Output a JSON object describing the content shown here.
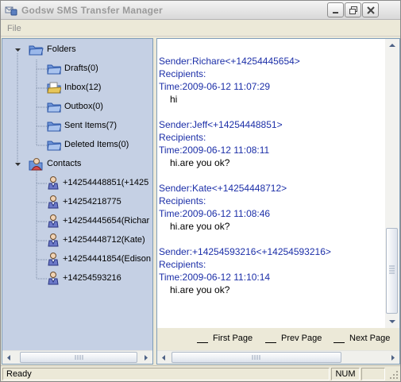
{
  "window": {
    "title": "Godsw SMS Transfer Manager",
    "buttons": [
      "minimize",
      "maximize",
      "close"
    ]
  },
  "menu": {
    "file_label": "File"
  },
  "tree": {
    "folders_label": "Folders",
    "folders": [
      {
        "label": "Drafts(0)",
        "icon": "folder-icon"
      },
      {
        "label": "Inbox(12)",
        "icon": "folder-open-icon"
      },
      {
        "label": "Outbox(0)",
        "icon": "folder-icon"
      },
      {
        "label": "Sent Items(7)",
        "icon": "folder-icon"
      },
      {
        "label": "Deleted Items(0)",
        "icon": "folder-icon"
      }
    ],
    "contacts_label": "Contacts",
    "contacts": [
      {
        "label": "+14254448851(+1425",
        "icon": "contact-icon"
      },
      {
        "label": "+14254218775",
        "icon": "contact-icon"
      },
      {
        "label": "+14254445654(Richar",
        "icon": "contact-icon"
      },
      {
        "label": "+14254448712(Kate)",
        "icon": "contact-icon"
      },
      {
        "label": "+14254441854(Edison",
        "icon": "contact-icon"
      },
      {
        "label": "+14254593216",
        "icon": "contact-icon"
      }
    ]
  },
  "messages": [
    {
      "sender": "Sender:Richare<+14254445654>",
      "recipients": "Recipients:",
      "time": "Time:2009-06-12 11:07:29",
      "body": "hi"
    },
    {
      "sender": "Sender:Jeff<+14254448851>",
      "recipients": "Recipients:",
      "time": "Time:2009-06-12 11:08:11",
      "body": "hi.are you ok?"
    },
    {
      "sender": "Sender:Kate<+14254448712>",
      "recipients": "Recipients:",
      "time": "Time:2009-06-12 11:08:46",
      "body": "hi.are you ok?"
    },
    {
      "sender": "Sender:+14254593216<+14254593216>",
      "recipients": "Recipients:",
      "time": "Time:2009-06-12 11:10:14",
      "body": "hi.are you ok?"
    }
  ],
  "pager": {
    "first_label": "First Page",
    "prev_label": "Prev Page",
    "next_label": "Next Page"
  },
  "status": {
    "text": "Ready",
    "num": "NUM"
  },
  "colors": {
    "tree_background": "#c5d0e4",
    "message_header": "#1c2fa8",
    "title_text": "#9a9a9a"
  }
}
